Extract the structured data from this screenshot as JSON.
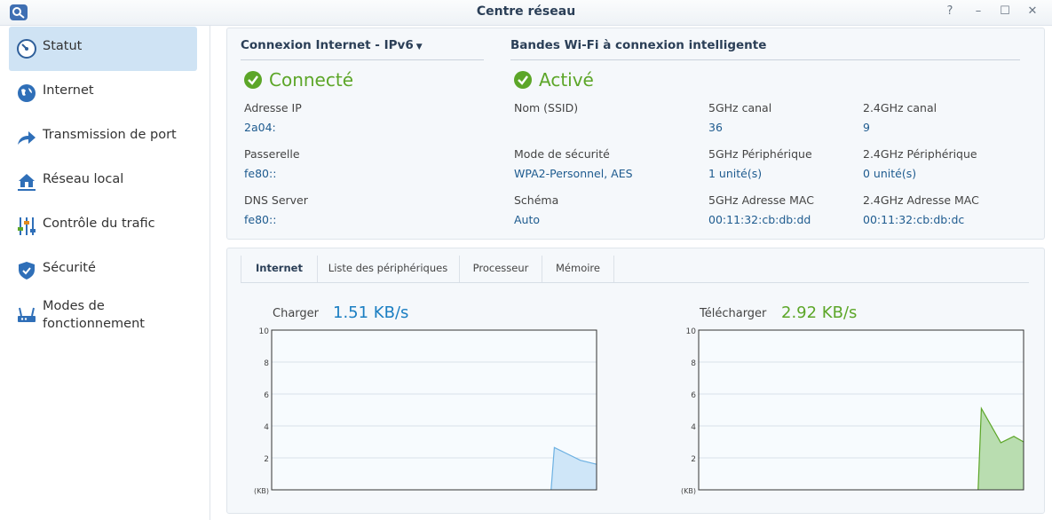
{
  "window": {
    "title": "Centre réseau",
    "controls": [
      "?",
      "–",
      "☐",
      "✕"
    ]
  },
  "sidebar": {
    "items": [
      {
        "label": "Statut",
        "icon": "speedometer-icon",
        "active": true
      },
      {
        "label": "Internet",
        "icon": "globe-icon",
        "active": false
      },
      {
        "label": "Transmission de port",
        "icon": "forward-arrow-icon",
        "active": false
      },
      {
        "label": "Réseau local",
        "icon": "house-network-icon",
        "active": false
      },
      {
        "label": "Contrôle du trafic",
        "icon": "sliders-icon",
        "active": false
      },
      {
        "label": "Sécurité",
        "icon": "shield-icon",
        "active": false
      },
      {
        "label": "Modes de fonctionnement",
        "icon": "router-icon",
        "active": false
      }
    ]
  },
  "internet": {
    "title": "Connexion Internet - ",
    "ip_mode": "IPv6",
    "status": "Connecté",
    "ip_label": "Adresse IP",
    "ip_value": "2a04:",
    "gateway_label": "Passerelle",
    "gateway_value": "fe80::",
    "dns_label": "DNS Server",
    "dns_value": "fe80::"
  },
  "wifi": {
    "title": "Bandes Wi-Fi à connexion intelligente",
    "status": "Activé",
    "ssid_label": "Nom (SSID)",
    "ssid_value": "",
    "security_label": "Mode de sécurité",
    "security_value": "WPA2-Personnel, AES",
    "schema_label": "Schéma",
    "schema_value": "Auto",
    "ch5_label": "5GHz canal",
    "ch5_value": "36",
    "dev5_label": "5GHz Périphérique",
    "dev5_value": "1 unité(s)",
    "mac5_label": "5GHz Adresse MAC",
    "mac5_value": "00:11:32:cb:db:dd",
    "ch24_label": "2.4GHz canal",
    "ch24_value": "9",
    "dev24_label": "2.4GHz Périphérique",
    "dev24_value": "0 unité(s)",
    "mac24_label": "2.4GHz Adresse MAC",
    "mac24_value": "00:11:32:cb:db:dc"
  },
  "tabs": [
    "Internet",
    "Liste des périphériques",
    "Processeur",
    "Mémoire"
  ],
  "upload": {
    "label": "Charger",
    "rate": "1.51 KB/s",
    "color": "#1a7ec2"
  },
  "download": {
    "label": "Télécharger",
    "rate": "2.92 KB/s",
    "color": "#5ca628"
  },
  "chart_data": [
    {
      "type": "area",
      "title": "Charger",
      "ylabel": "(KB)",
      "ylim": [
        0,
        10
      ],
      "yticks": [
        "2",
        "4",
        "6",
        "8",
        "10"
      ],
      "x": [
        0.86,
        0.87,
        0.95,
        1.0
      ],
      "values": [
        0,
        2.65,
        1.85,
        1.6
      ],
      "color": "#6db1e2",
      "fill": "#cfe6f8"
    },
    {
      "type": "area",
      "title": "Télécharger",
      "ylabel": "(KB)",
      "ylim": [
        0,
        10
      ],
      "yticks": [
        "2",
        "4",
        "6",
        "8",
        "10"
      ],
      "x": [
        0.86,
        0.87,
        0.93,
        0.97,
        1.0
      ],
      "values": [
        0,
        5.1,
        2.95,
        3.35,
        3.0
      ],
      "color": "#5ca628",
      "fill": "#b9ddb0"
    }
  ]
}
